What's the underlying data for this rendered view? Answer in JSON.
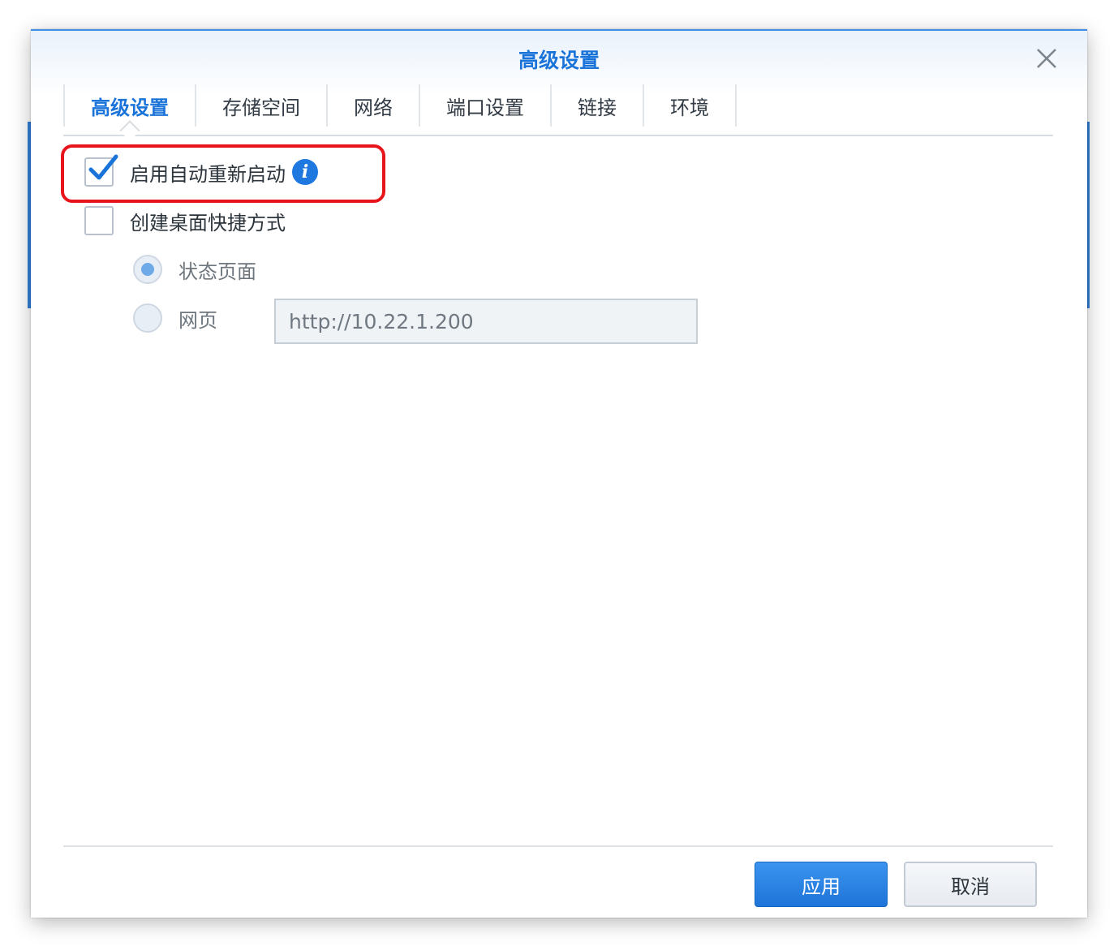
{
  "dialog": {
    "title": "高级设置"
  },
  "tabs": [
    {
      "label": "高级设置",
      "active": true
    },
    {
      "label": "存储空间",
      "active": false
    },
    {
      "label": "网络",
      "active": false
    },
    {
      "label": "端口设置",
      "active": false
    },
    {
      "label": "链接",
      "active": false
    },
    {
      "label": "环境",
      "active": false
    }
  ],
  "options": {
    "auto_restart": {
      "label": "启用自动重新启动",
      "checked": true
    },
    "desktop_shortcut": {
      "label": "创建桌面快捷方式",
      "checked": false
    },
    "status_page": {
      "label": "状态页面",
      "selected": true
    },
    "web_page": {
      "label": "网页",
      "selected": false,
      "url": "http://10.22.1.200"
    }
  },
  "buttons": {
    "apply": "应用",
    "cancel": "取消"
  },
  "colors": {
    "accent": "#1a73d9",
    "highlight": "#e8141c"
  }
}
